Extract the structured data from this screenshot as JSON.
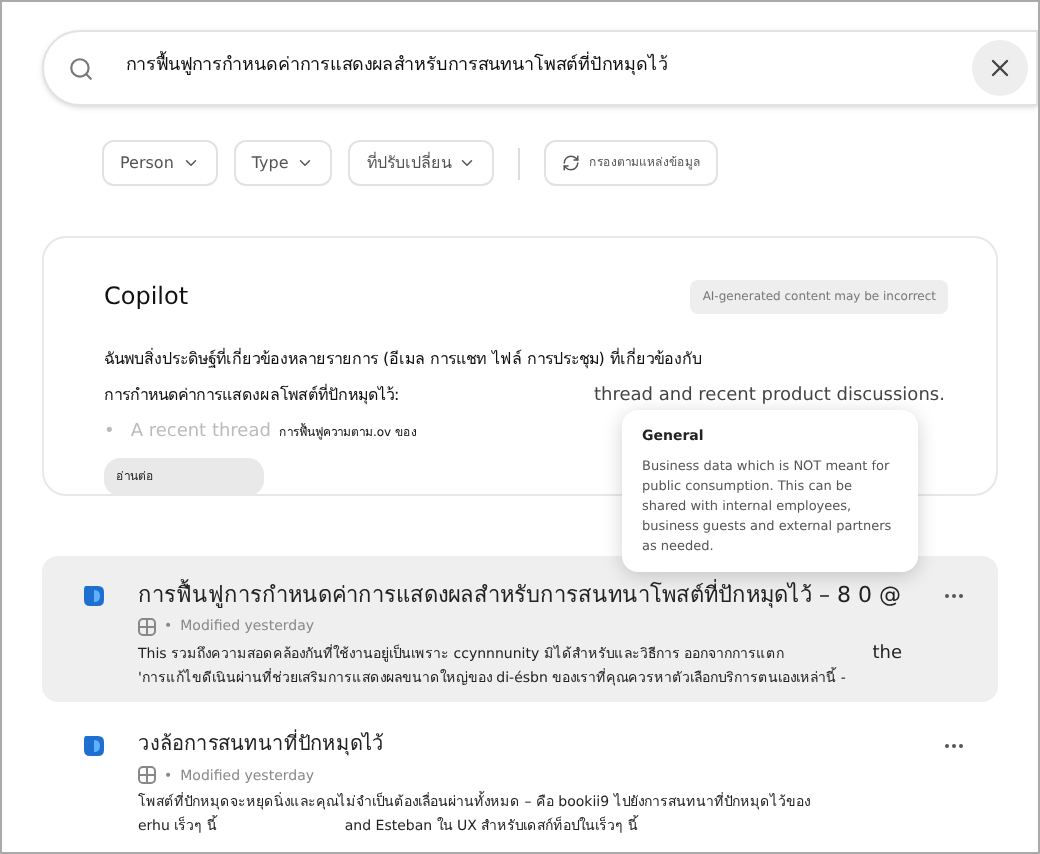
{
  "search": {
    "value": "การฟื้นฟูการกำหนดค่าการแสดงผลสำหรับการสนทนาโพสต์ที่ปักหมุดไว้"
  },
  "filters": [
    {
      "kind": "dropdown",
      "label": "Person"
    },
    {
      "kind": "dropdown",
      "label": "Type"
    },
    {
      "kind": "dropdown",
      "label": "ที่ปรับเปลี่ยน"
    },
    {
      "kind": "source",
      "label": "กรองตามแหล่งข้อมูล"
    }
  ],
  "copilot": {
    "title": "Copilot",
    "disclaimer": "AI-generated content may be incorrect",
    "summary_line_1": "ฉันพบสิ่งประดิษฐ์ที่เกี่ยวข้องหลายรายการ (อีเมล การแชท ไฟล์ การประชุม) ที่เกี่ยวข้องกับ",
    "summary_line_2": "การกำหนดค่าการแสดงผลโพสต์ที่ปักหมุดไว้:",
    "summary_fragment": "thread and recent product discussions.",
    "bullet_mark": "•",
    "bullet_faded": "A recent thread",
    "bullet_text": "การฟื้นฟูความตาม.ov ของ",
    "read_more": "อ่านต่อ"
  },
  "tooltip": {
    "title": "General",
    "body": "Business data which is NOT meant for public consumption. This can be shared with internal employees, business guests and external partners as needed."
  },
  "results": [
    {
      "title": "การฟื้นฟูการกำหนดค่าการแสดงผลสำหรับการสนทนาโพสต์ที่ปักหมุดไว้ – 8 0 @",
      "separator": "•",
      "meta": "Modified yesterday",
      "selected": true,
      "line_1": "This รวมถึงความสอดคล้องกันที่ใช้งานอยู่เป็นเพราะ ccynnnunity มิได้สำหรับและวิธีการ ออกจากการแตก",
      "line_1_tail": "the",
      "line_2": "'การแก้ไขดีเนินผ่านที่ช่วยเสริมการแสดงผลขนาดใหญ่ของ di-ésbn ของเราที่คุณควรหาตัวเลือกบริการตนเองเหล่านี้ -"
    },
    {
      "title": "วงล้อการสนทนาที่ปักหมุดไว้",
      "separator": "•",
      "meta": "Modified yesterday",
      "selected": false,
      "line_1": "โพสต์ที่ปักหมุดจะหยุดนิ่งและคุณไม่จำเป็นต้องเลื่อนผ่านทั้งหมด – คือ bookii9 ไปยังการสนทนาที่ปักหมุดไว้ของ",
      "line_2": "erhu เร็วๆ นี้",
      "line_2_tail": "and Esteban ใน UX สำหรับเดสก์ท็อปในเร็วๆ นี้"
    }
  ]
}
